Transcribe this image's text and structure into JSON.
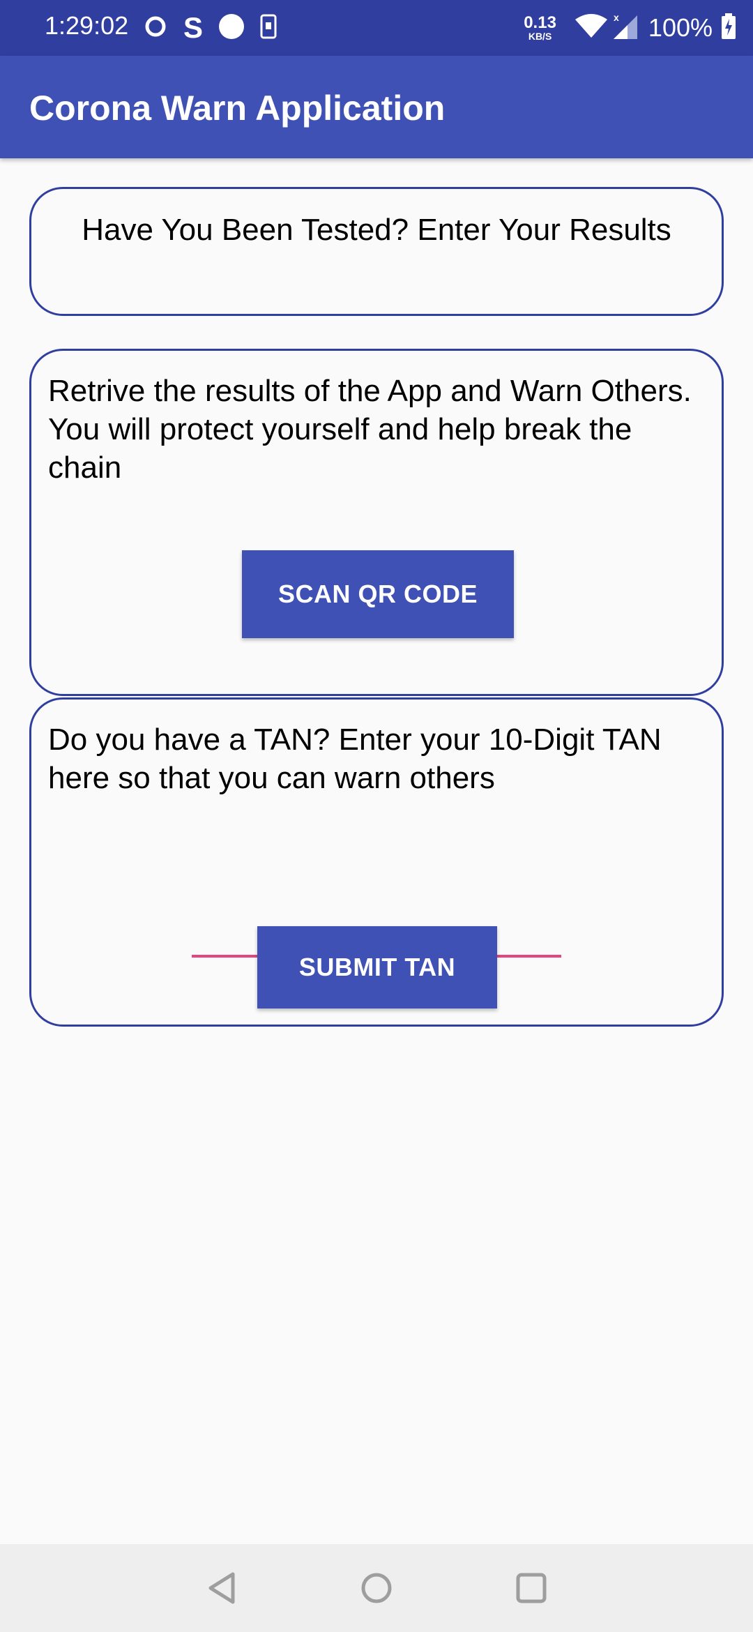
{
  "status_bar": {
    "time": "1:29:02",
    "net_speed_value": "0.13",
    "net_speed_unit": "KB/S",
    "battery": "100%",
    "icons": [
      "sync-icon",
      "s-app-icon",
      "circle-notification-icon",
      "phone-notification-icon",
      "wifi-icon",
      "cellular-signal-icon",
      "battery-charging-icon"
    ]
  },
  "app_bar": {
    "title": "Corona Warn Application"
  },
  "test_card": {
    "text": "Have You Been Tested? Enter Your Results"
  },
  "qr_card": {
    "text": "Retrive the results of the App and Warn Others. You will protect yourself and help break the chain",
    "button_label": "SCAN QR CODE"
  },
  "tan_card": {
    "text": "Do you have a TAN? Enter your 10-Digit TAN here so that you can warn others",
    "input_value": "",
    "input_placeholder": "",
    "button_label": "SUBMIT TAN"
  },
  "nav_bar": {
    "icons": [
      "back-icon",
      "home-icon",
      "recents-icon"
    ]
  },
  "colors": {
    "status_bar": "#303f9f",
    "app_bar": "#3f51b5",
    "button": "#3f51b5",
    "card_border": "#303f9f",
    "input_underline": "#e2457f",
    "background": "#fafafa"
  }
}
